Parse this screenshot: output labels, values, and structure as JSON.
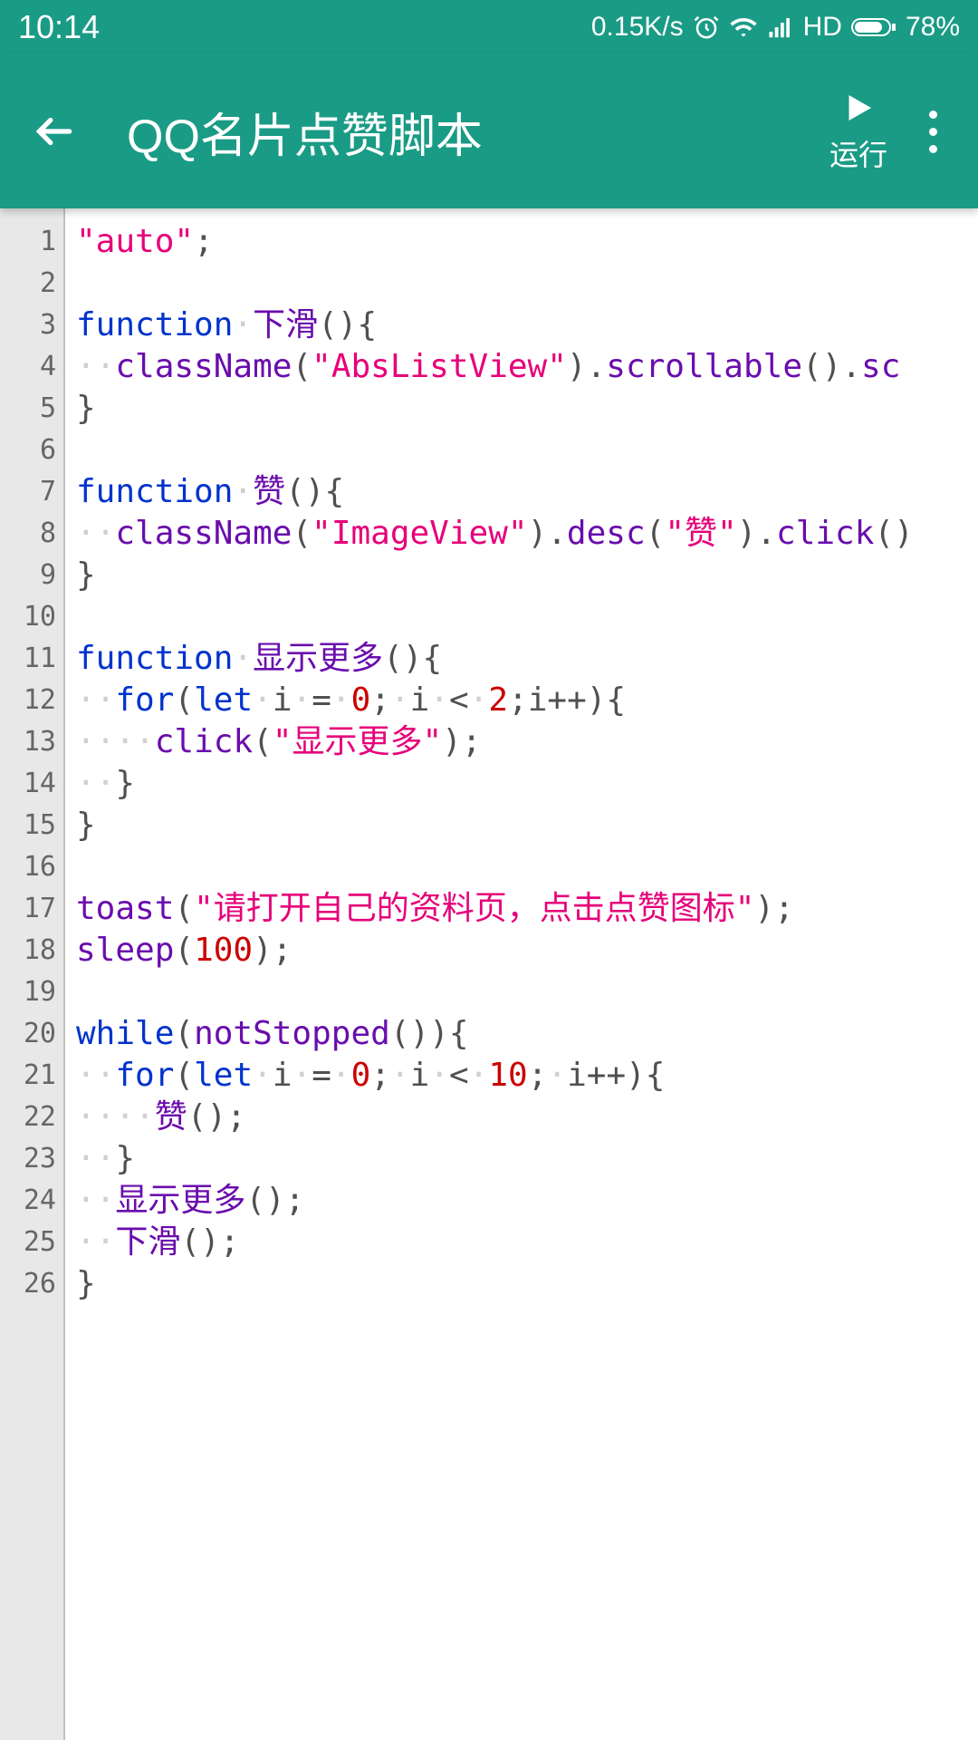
{
  "statusbar": {
    "time": "10:14",
    "speed": "0.15K/s",
    "hd": "HD",
    "battery": "78%"
  },
  "appbar": {
    "title": "QQ名片点赞脚本",
    "run_label": "运行"
  },
  "code": {
    "lines": [
      [
        {
          "c": "str",
          "t": "\"auto\""
        },
        {
          "c": "punc",
          "t": ";"
        }
      ],
      [],
      [
        {
          "c": "kw",
          "t": "function"
        },
        {
          "c": "ws",
          "t": "·"
        },
        {
          "c": "fn",
          "t": "下滑"
        },
        {
          "c": "punc",
          "t": "(){"
        }
      ],
      [
        {
          "c": "ws",
          "t": "··"
        },
        {
          "c": "fn",
          "t": "className"
        },
        {
          "c": "punc",
          "t": "("
        },
        {
          "c": "str",
          "t": "\"AbsListView\""
        },
        {
          "c": "punc",
          "t": ")."
        },
        {
          "c": "fn",
          "t": "scrollable"
        },
        {
          "c": "punc",
          "t": "()."
        },
        {
          "c": "fn",
          "t": "sc"
        }
      ],
      [
        {
          "c": "punc",
          "t": "}"
        }
      ],
      [],
      [
        {
          "c": "kw",
          "t": "function"
        },
        {
          "c": "ws",
          "t": "·"
        },
        {
          "c": "fn",
          "t": "赞"
        },
        {
          "c": "punc",
          "t": "(){"
        }
      ],
      [
        {
          "c": "ws",
          "t": "··"
        },
        {
          "c": "fn",
          "t": "className"
        },
        {
          "c": "punc",
          "t": "("
        },
        {
          "c": "str",
          "t": "\"ImageView\""
        },
        {
          "c": "punc",
          "t": ")."
        },
        {
          "c": "fn",
          "t": "desc"
        },
        {
          "c": "punc",
          "t": "("
        },
        {
          "c": "str",
          "t": "\"赞\""
        },
        {
          "c": "punc",
          "t": ")."
        },
        {
          "c": "fn",
          "t": "click"
        },
        {
          "c": "punc",
          "t": "()"
        }
      ],
      [
        {
          "c": "punc",
          "t": "}"
        }
      ],
      [],
      [
        {
          "c": "kw",
          "t": "function"
        },
        {
          "c": "ws",
          "t": "·"
        },
        {
          "c": "fn",
          "t": "显示更多"
        },
        {
          "c": "punc",
          "t": "(){"
        }
      ],
      [
        {
          "c": "ws",
          "t": "··"
        },
        {
          "c": "kw",
          "t": "for"
        },
        {
          "c": "punc",
          "t": "("
        },
        {
          "c": "kw",
          "t": "let"
        },
        {
          "c": "ws",
          "t": "·"
        },
        {
          "c": "punc",
          "t": "i"
        },
        {
          "c": "ws",
          "t": "·"
        },
        {
          "c": "punc",
          "t": "="
        },
        {
          "c": "ws",
          "t": "·"
        },
        {
          "c": "num",
          "t": "0"
        },
        {
          "c": "punc",
          "t": ";"
        },
        {
          "c": "ws",
          "t": "·"
        },
        {
          "c": "punc",
          "t": "i"
        },
        {
          "c": "ws",
          "t": "·"
        },
        {
          "c": "punc",
          "t": "<"
        },
        {
          "c": "ws",
          "t": "·"
        },
        {
          "c": "num",
          "t": "2"
        },
        {
          "c": "punc",
          "t": ";i++){"
        }
      ],
      [
        {
          "c": "ws",
          "t": "····"
        },
        {
          "c": "fn",
          "t": "click"
        },
        {
          "c": "punc",
          "t": "("
        },
        {
          "c": "str",
          "t": "\"显示更多\""
        },
        {
          "c": "punc",
          "t": ");"
        }
      ],
      [
        {
          "c": "ws",
          "t": "··"
        },
        {
          "c": "punc",
          "t": "}"
        }
      ],
      [
        {
          "c": "punc",
          "t": "}"
        }
      ],
      [],
      [
        {
          "c": "fn",
          "t": "toast"
        },
        {
          "c": "punc",
          "t": "("
        },
        {
          "c": "str",
          "t": "\"请打开自己的资料页，点击点赞图标\""
        },
        {
          "c": "punc",
          "t": ");"
        }
      ],
      [
        {
          "c": "fn",
          "t": "sleep"
        },
        {
          "c": "punc",
          "t": "("
        },
        {
          "c": "num",
          "t": "100"
        },
        {
          "c": "punc",
          "t": ");"
        }
      ],
      [],
      [
        {
          "c": "kw",
          "t": "while"
        },
        {
          "c": "punc",
          "t": "("
        },
        {
          "c": "fn",
          "t": "notStopped"
        },
        {
          "c": "punc",
          "t": "()){"
        }
      ],
      [
        {
          "c": "ws",
          "t": "··"
        },
        {
          "c": "kw",
          "t": "for"
        },
        {
          "c": "punc",
          "t": "("
        },
        {
          "c": "kw",
          "t": "let"
        },
        {
          "c": "ws",
          "t": "·"
        },
        {
          "c": "punc",
          "t": "i"
        },
        {
          "c": "ws",
          "t": "·"
        },
        {
          "c": "punc",
          "t": "="
        },
        {
          "c": "ws",
          "t": "·"
        },
        {
          "c": "num",
          "t": "0"
        },
        {
          "c": "punc",
          "t": ";"
        },
        {
          "c": "ws",
          "t": "·"
        },
        {
          "c": "punc",
          "t": "i"
        },
        {
          "c": "ws",
          "t": "·"
        },
        {
          "c": "punc",
          "t": "<"
        },
        {
          "c": "ws",
          "t": "·"
        },
        {
          "c": "num",
          "t": "10"
        },
        {
          "c": "punc",
          "t": ";"
        },
        {
          "c": "ws",
          "t": "·"
        },
        {
          "c": "punc",
          "t": "i++){"
        }
      ],
      [
        {
          "c": "ws",
          "t": "····"
        },
        {
          "c": "fn",
          "t": "赞"
        },
        {
          "c": "punc",
          "t": "();"
        }
      ],
      [
        {
          "c": "ws",
          "t": "··"
        },
        {
          "c": "punc",
          "t": "}"
        }
      ],
      [
        {
          "c": "ws",
          "t": "··"
        },
        {
          "c": "fn",
          "t": "显示更多"
        },
        {
          "c": "punc",
          "t": "();"
        }
      ],
      [
        {
          "c": "ws",
          "t": "··"
        },
        {
          "c": "fn",
          "t": "下滑"
        },
        {
          "c": "punc",
          "t": "();"
        }
      ],
      [
        {
          "c": "punc",
          "t": "}"
        }
      ]
    ]
  }
}
